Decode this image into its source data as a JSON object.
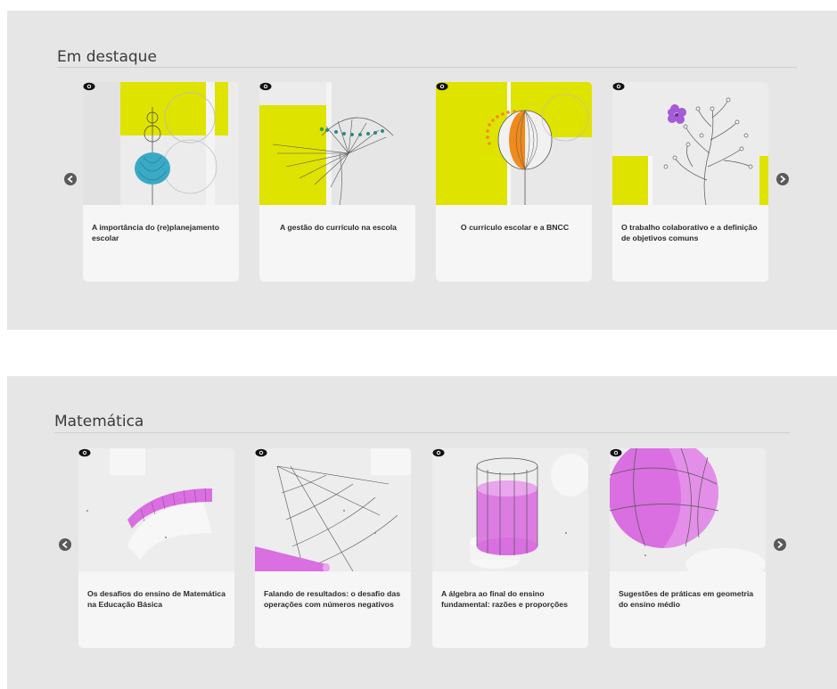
{
  "sections": [
    {
      "title": "Em destaque",
      "cards": [
        {
          "title": "A importância do (re)planejamento escolar"
        },
        {
          "title": "A gestão do currículo na escola"
        },
        {
          "title": "O currículo escolar e a BNCC"
        },
        {
          "title": "O trabalho colaborativo e a definição de objetivos comuns"
        }
      ]
    },
    {
      "title": "Matemática",
      "cards": [
        {
          "title": "Os desafios do ensino de Matemática na Educação Básica"
        },
        {
          "title": "Falando de resultados: o desafio das operações com números negativos"
        },
        {
          "title": "A álgebra ao final do ensino fundamental: razões e proporções"
        },
        {
          "title": "Sugestões de práticas em geometria do ensino médio"
        }
      ]
    }
  ],
  "icons": {
    "view": "eye-icon",
    "prev": "arrow-left-circle-icon",
    "next": "arrow-right-circle-icon"
  },
  "colors": {
    "section_bg": "#e6e6e6",
    "card_bg": "#f6f6f7",
    "accent_yellow": "#dfe300",
    "accent_magenta": "#d96fe0",
    "accent_teal": "#3aa9c4",
    "accent_orange": "#f08a1c"
  }
}
